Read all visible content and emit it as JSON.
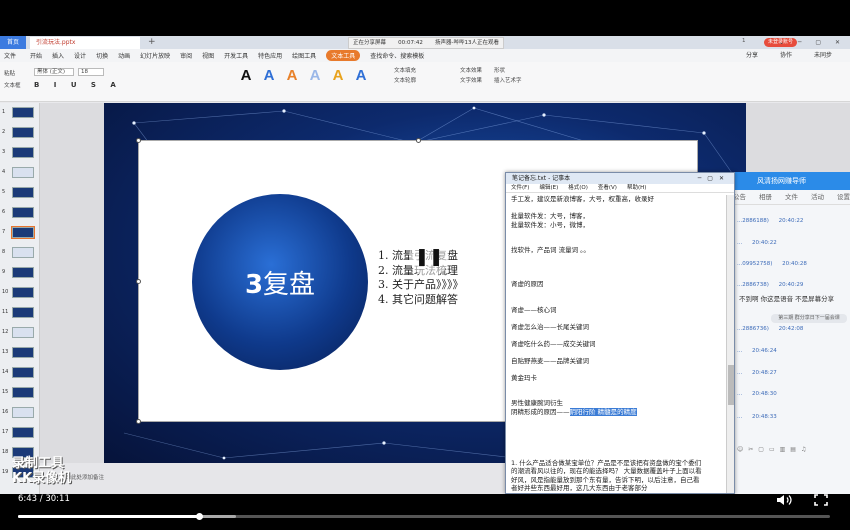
{
  "app": {
    "tab_home": "首页",
    "doc_tab": "引流玩法.pptx",
    "new_tab": "+",
    "share_status": "正在分享屏幕",
    "share_time": "00:07:42",
    "share_mic": "扬声器-哔哔13人正在观看",
    "login": "未登录账号",
    "tab_count": "1"
  },
  "menu": {
    "file": "文件",
    "items": [
      "开始",
      "插入",
      "设计",
      "切换",
      "动画",
      "幻灯片放映",
      "审阅",
      "视图",
      "开发工具",
      "特色应用",
      "绘图工具",
      "文本工具"
    ],
    "active_index": 11,
    "search_hint": "查找命令、搜索模板",
    "right": [
      "分享",
      "协作",
      "未同步"
    ]
  },
  "ribbon": {
    "left_labels": [
      "粘贴",
      "文本框"
    ],
    "font_name": "黑体 (正文)",
    "font_size": "18",
    "format_buttons": "B I U S A",
    "style_letters": [
      "A",
      "A",
      "A",
      "A",
      "A",
      "A"
    ],
    "style_colors": [
      "#111111",
      "#2f6fd6",
      "#e8812a",
      "#9ab7e8",
      "#e8a21c",
      "#2f6fd6"
    ],
    "tools": [
      "文本填充",
      "文本轮廓"
    ],
    "tools2": [
      "文本效果",
      "文字效果"
    ],
    "tools3": [
      "形状",
      "插入艺术字"
    ]
  },
  "slides": {
    "count_visible": 19,
    "selected": 7
  },
  "slide": {
    "big_number": "3",
    "title": "复盘",
    "agenda": [
      "1. 流量引流复盘",
      "2. 流量玩法梳理",
      "3. 关于产品》》》》",
      "4. 其它问题解答"
    ],
    "pause_icon": "❚❚",
    "notes_placeholder": "单击此处添加备注"
  },
  "notepad": {
    "title": "笔记备忘.txt - 记事本",
    "menus": [
      "文件(F)",
      "编辑(E)",
      "格式(O)",
      "查看(V)",
      "帮助(H)"
    ],
    "lines": [
      "手工发，建议是新浪博客，大号，权重高，收录好",
      "",
      "批量软件发：大号，博客，",
      "批量软件发：小号，微博，",
      "",
      "",
      "找软件，产品词 流量词 。。",
      "",
      "",
      "",
      "肾虚的原因",
      "",
      "",
      "肾虚——核心词",
      "",
      "肾虚怎么治——长尾关键词",
      "",
      "肾虚吃什么药——成交关键词",
      "",
      "自贴野燕麦——品牌关键词",
      "",
      "黄金玛卡",
      "",
      "",
      "男性健康腕词衍生",
      "阴精形成的原因——",
      "",
      "",
      "",
      "",
      "",
      "1. 什么产品适合做某宝单位？产品是不是该把有资盘做的宝个委们",
      "的潮流看风以往的，现在的能选择吗？ 大量数据覆盖叶子上面以看",
      "好风，风是指能量放到那个东有量，告诉下明，以后注意，自己看",
      "者好并些东西最好用，这几大东西由于老客部分",
      "",
      "第一个问题，我们做那到人关键词，她到开发现了，如我们的摸位",
      "来给我们，怎么办？也有用道中解决",
      "",
      "第二个问题，我分先关于什么什么"
    ],
    "highlight": "阴阳行阶 精髓是的精度"
  },
  "chat": {
    "header": "风清扬网赚导师",
    "tabs": [
      "聊天",
      "公告",
      "相册",
      "文件",
      "活动",
      "设置"
    ],
    "messages": [
      {
        "user": "...2886188)",
        "time": "20:40:22"
      },
      {
        "user": "...",
        "time": "20:40:22"
      },
      {
        "user": "...09952758)",
        "time": "20:40:28"
      },
      {
        "user": "...2886738)",
        "time": "20:40:29"
      }
    ],
    "msg_text": "不到啊  你这是语音  不是屏幕分享",
    "pill": "第三期 群分享日下一届会课",
    "later": [
      {
        "user": "...2886736)",
        "time": "20:42:08"
      },
      {
        "user": "...",
        "time": "20:46:24"
      },
      {
        "user": "...",
        "time": "20:48:27"
      },
      {
        "user": "...",
        "time": "20:48:30"
      },
      {
        "user": "...",
        "time": "20:48:33"
      }
    ],
    "toolbar": "☺✂▢▭▥▤♫"
  },
  "watermark": [
    "录制工具",
    "KK录像机"
  ],
  "player": {
    "current": "6:43",
    "total": "30:11",
    "time_display": "6:43 / 30:11",
    "played_fraction": 0.2227,
    "buffered_fraction": 0.269
  }
}
